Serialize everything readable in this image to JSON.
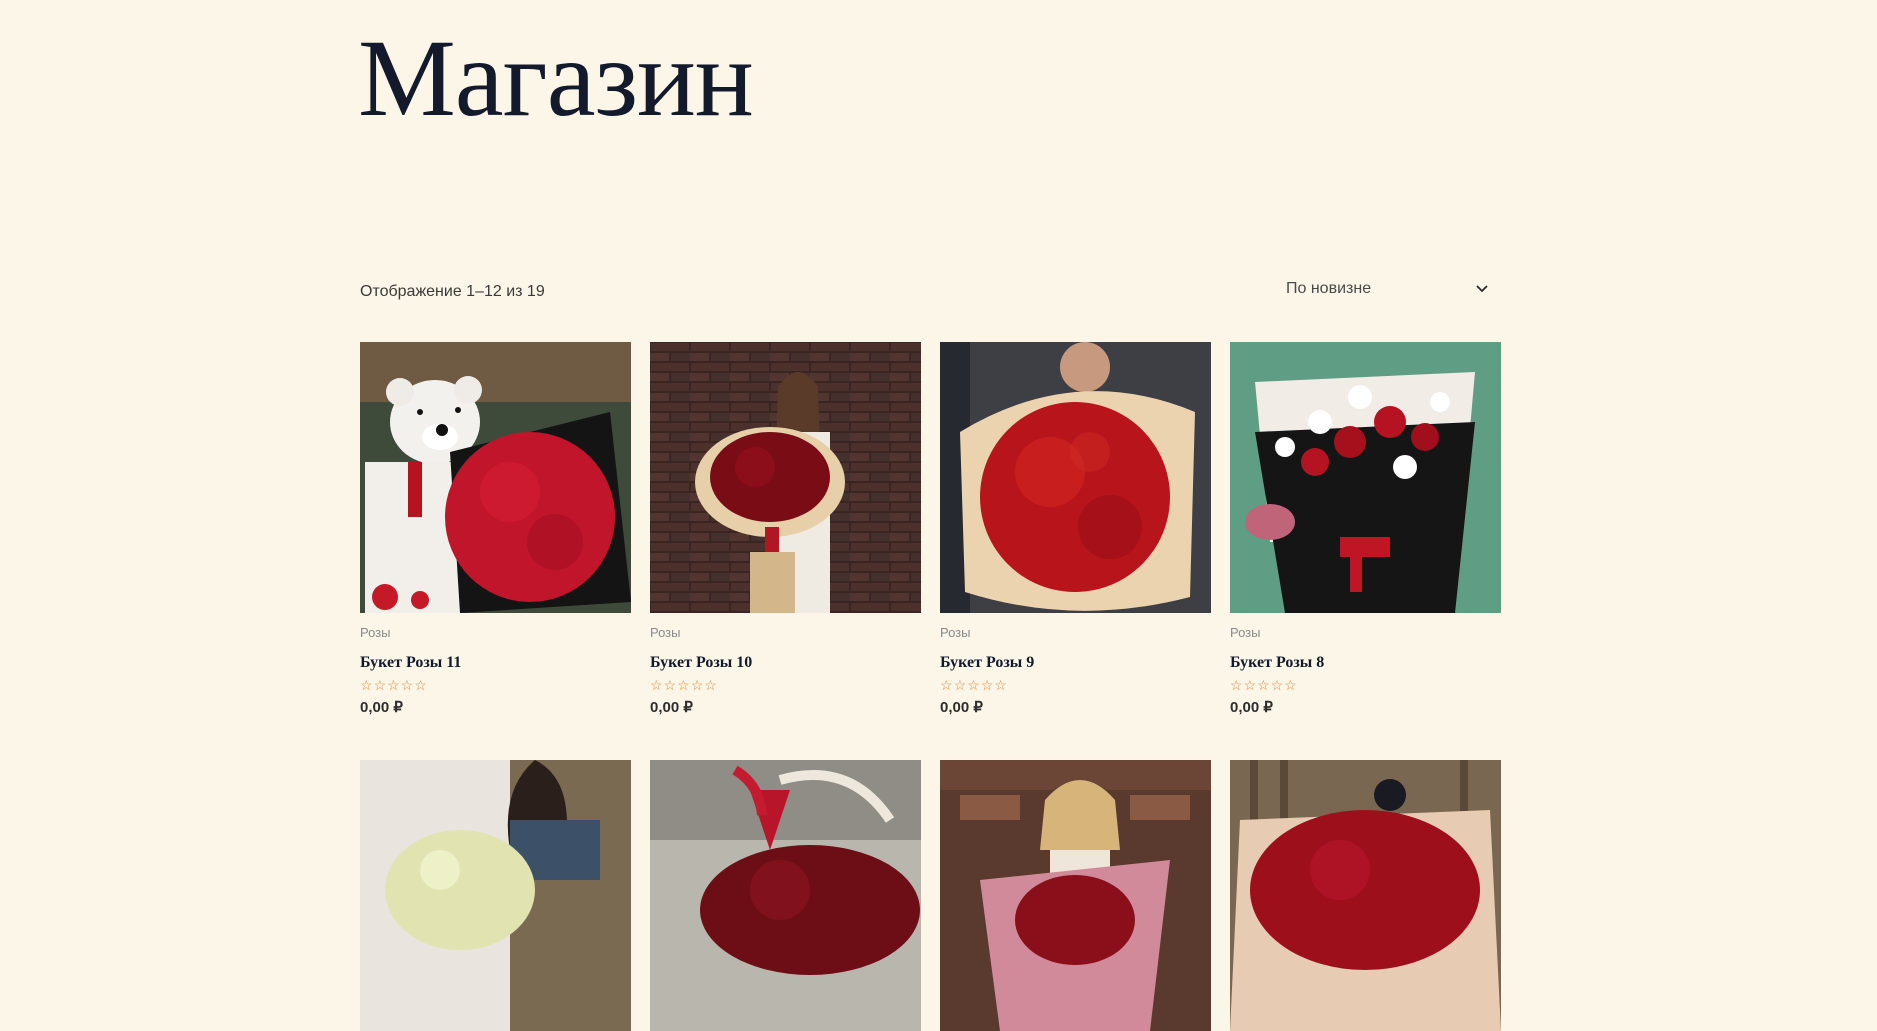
{
  "page": {
    "title": "Магазин"
  },
  "toolbar": {
    "result_count": "Отображение 1–12 из 19",
    "ordering_selected": "По новизне"
  },
  "products": [
    {
      "category": "Розы",
      "name": "Букет Розы 11",
      "price": "0,00 ₽",
      "rating": 0,
      "image": "teddy-bear-roses"
    },
    {
      "category": "Розы",
      "name": "Букет Розы 10",
      "price": "0,00 ₽",
      "rating": 0,
      "image": "girl-roses-brick-wall"
    },
    {
      "category": "Розы",
      "name": "Букет Розы 9",
      "price": "0,00 ₽",
      "rating": 0,
      "image": "red-roses-kraft"
    },
    {
      "category": "Розы",
      "name": "Букет Розы 8",
      "price": "0,00 ₽",
      "rating": 0,
      "image": "red-white-roses-black-wrap"
    },
    {
      "image": "white-roses-girl"
    },
    {
      "image": "roses-basket-ribbon"
    },
    {
      "image": "woman-roses-brick"
    },
    {
      "image": "red-roses-wood"
    }
  ],
  "colors": {
    "background": "#fbf6e7",
    "title": "#121a2c",
    "star": "#e0873a",
    "rose_red": "#b3111e"
  }
}
